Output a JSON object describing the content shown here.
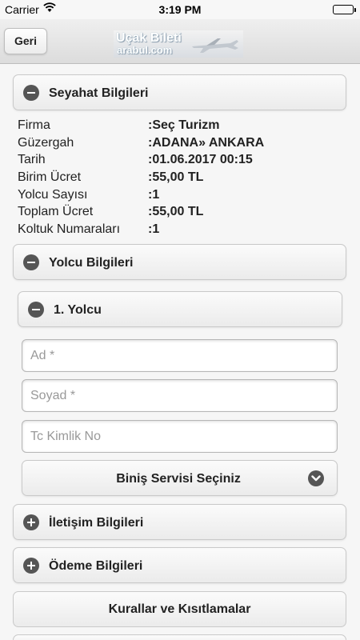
{
  "status_bar": {
    "carrier": "Carrier",
    "time": "3:19 PM"
  },
  "header": {
    "back_label": "Geri",
    "logo_line1": "Uçak Bileti",
    "logo_line2": "arabul.com"
  },
  "sections": {
    "travel": "Seyahat Bilgileri",
    "passenger": "Yolcu Bilgileri",
    "passenger_1": "1. Yolcu",
    "contact": "İletişim Bilgileri",
    "payment": "Ödeme Bilgileri"
  },
  "travel_info": {
    "firma_label": "Firma",
    "firma_value": ":Seç Turizm",
    "route_label": "Güzergah",
    "route_prefix": ":",
    "route_from": "ADANA",
    "route_sep": "» ",
    "route_to": "ANKARA",
    "date_label": "Tarih",
    "date_value": ":01.06.2017 00:15",
    "unit_price_label": "Birim Ücret",
    "unit_price_value": ":55,00 TL",
    "count_label": "Yolcu Sayısı",
    "count_value": ":1",
    "total_label": "Toplam Ücret",
    "total_value": ":55,00 TL",
    "seat_label": "Koltuk Numaraları",
    "seat_prefix": ":",
    "seat_value": "1"
  },
  "form": {
    "name_placeholder": "Ad *",
    "surname_placeholder": "Soyad *",
    "tc_placeholder": "Tc Kimlik No",
    "boarding_select": "Biniş Servisi Seçiniz"
  },
  "rules_button": "Kurallar ve Kısıtlamalar",
  "colors": {
    "accent_red": "#e31d1d",
    "icon_grey": "#555555"
  }
}
